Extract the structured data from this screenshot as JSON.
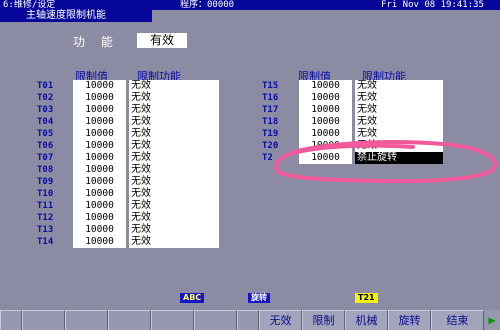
{
  "header": {
    "mode": "6:维修/设定",
    "program": "程序：00000",
    "datetime": "Fri Nov 08 19:41:35"
  },
  "screen_title": "主轴速度限制机能",
  "function": {
    "label": "功 能",
    "value": "有效"
  },
  "left_table": {
    "headers": {
      "limit": "限制值",
      "func": "限制功能"
    },
    "rows": [
      {
        "t": "T01",
        "limit": "10000",
        "func": "无效"
      },
      {
        "t": "T02",
        "limit": "10000",
        "func": "无效"
      },
      {
        "t": "T03",
        "limit": "10000",
        "func": "无效"
      },
      {
        "t": "T04",
        "limit": "10000",
        "func": "无效"
      },
      {
        "t": "T05",
        "limit": "10000",
        "func": "无效"
      },
      {
        "t": "T06",
        "limit": "10000",
        "func": "无效"
      },
      {
        "t": "T07",
        "limit": "10000",
        "func": "无效"
      },
      {
        "t": "T08",
        "limit": "10000",
        "func": "无效"
      },
      {
        "t": "T09",
        "limit": "10000",
        "func": "无效"
      },
      {
        "t": "T10",
        "limit": "10000",
        "func": "无效"
      },
      {
        "t": "T11",
        "limit": "10000",
        "func": "无效"
      },
      {
        "t": "T12",
        "limit": "10000",
        "func": "无效"
      },
      {
        "t": "T13",
        "limit": "10000",
        "func": "无效"
      },
      {
        "t": "T14",
        "limit": "10000",
        "func": "无效"
      }
    ]
  },
  "right_table": {
    "headers": {
      "limit": "限制值",
      "func": "限制功能"
    },
    "rows": [
      {
        "t": "T15",
        "limit": "10000",
        "func": "无效"
      },
      {
        "t": "T16",
        "limit": "10000",
        "func": "无效"
      },
      {
        "t": "T17",
        "limit": "10000",
        "func": "无效"
      },
      {
        "t": "T18",
        "limit": "10000",
        "func": "无效"
      },
      {
        "t": "T19",
        "limit": "10000",
        "func": "无效"
      },
      {
        "t": "T20",
        "limit": "10000",
        "func": "无效"
      },
      {
        "t": "T2",
        "limit": "10000",
        "func": "禁止旋转"
      }
    ]
  },
  "status_badges": {
    "abc": "ABC",
    "mode": "旋转",
    "tool": "T21"
  },
  "badge_colors": {
    "abc_bg": "#1616c8",
    "abc_fg": "#ffff66",
    "mode_bg": "#1616c8",
    "mode_fg": "#ffffff",
    "tool_bg": "#f2f20a",
    "tool_fg": "#000000"
  },
  "annotation_color": "#f05a9a",
  "softkeys": [
    "无效",
    "限制",
    "机械",
    "旋转",
    "结束"
  ]
}
